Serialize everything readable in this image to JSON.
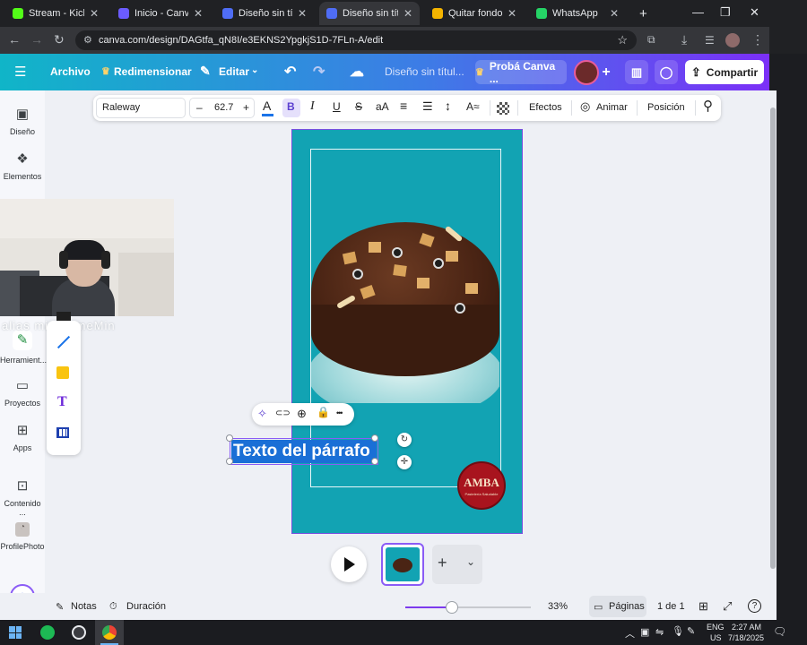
{
  "browser": {
    "tabs": [
      {
        "title": "Stream - Kick Das",
        "color": "#53fc18",
        "active": false
      },
      {
        "title": "Inicio - Canva",
        "color": "#6b5cff",
        "active": false
      },
      {
        "title": "Diseño sin título",
        "color": "#4f6df5",
        "active": false
      },
      {
        "title": "Diseño sin título",
        "color": "#4f6df5",
        "active": true
      },
      {
        "title": "Quitar fondo a im",
        "color": "#f4b400",
        "active": false
      },
      {
        "title": "WhatsApp",
        "color": "#25d366",
        "active": false
      }
    ],
    "new_tab": "+",
    "window_controls": [
      "—",
      "❐",
      "✕"
    ],
    "url": "canva.com/design/DAGtfa_qN8I/e3EKNS2YpgkjS1D-7FLn-A/edit"
  },
  "header": {
    "menu_icon": "☰",
    "file": "Archivo",
    "resize": "Redimensionar",
    "resize_icon": "♛",
    "edit": "Editar",
    "edit_icon": "✎",
    "undo": "↶",
    "redo": "↷",
    "cloud": "☁",
    "title": "Diseño sin títul...",
    "try_pro": "Probá Canva ...",
    "try_pro_icon": "♛",
    "plus": "+",
    "share": "Compartir",
    "share_icon": "⇪"
  },
  "sidebar": [
    {
      "label": "Diseño",
      "icon": "▣"
    },
    {
      "label": "Elementos",
      "icon": "❖"
    },
    {
      "label": "Herramient...",
      "icon": "✎"
    },
    {
      "label": "Proyectos",
      "icon": "▭"
    },
    {
      "label": "Apps",
      "icon": "⊞"
    },
    {
      "label": "Contenido ...",
      "icon": "⊡"
    },
    {
      "label": "ProfilePhoto",
      "icon": "◔"
    }
  ],
  "magic_icon": "✦",
  "overlay_text": "alias  mi....s.meMin",
  "toolbar": {
    "font": "Raleway",
    "minus": "–",
    "size": "62.7",
    "plus": "+",
    "color_letter": "A",
    "color_bar": "#1a73e8",
    "bold": "B",
    "italic": "I",
    "underline": "U",
    "strike": "S",
    "case": "aA",
    "align": "≡",
    "list": "☰",
    "spacing": "↕",
    "effects_short": "A≈",
    "effects": "Efectos",
    "animate_icon": "◎",
    "animate": "Animar",
    "position": "Posición",
    "paint_icon": "⚲"
  },
  "tools_flyout": {
    "items": [
      "pen",
      "line",
      "sticky",
      "text",
      "table"
    ],
    "text_glyph": "T"
  },
  "context_menu": [
    "✧",
    "⊂⊃",
    "⊕",
    "🔒",
    "•••"
  ],
  "canvas": {
    "page_color": "#12a3b3",
    "text_element": "Texto del párrafo",
    "logo": {
      "main": "AMBA",
      "sub": "Pastelería Saludable"
    },
    "rotate_icon": "↻",
    "move_icon": "✛"
  },
  "bottom": {
    "notes": "Notas",
    "duration": "Duración",
    "zoom": "33%",
    "zoom_fraction": 0.33,
    "pages": "Páginas",
    "page_count": "1 de 1",
    "help": "?"
  },
  "taskbar": {
    "lang": "ENG",
    "region": "US",
    "time": "2:27 AM",
    "date": "7/18/2025"
  }
}
